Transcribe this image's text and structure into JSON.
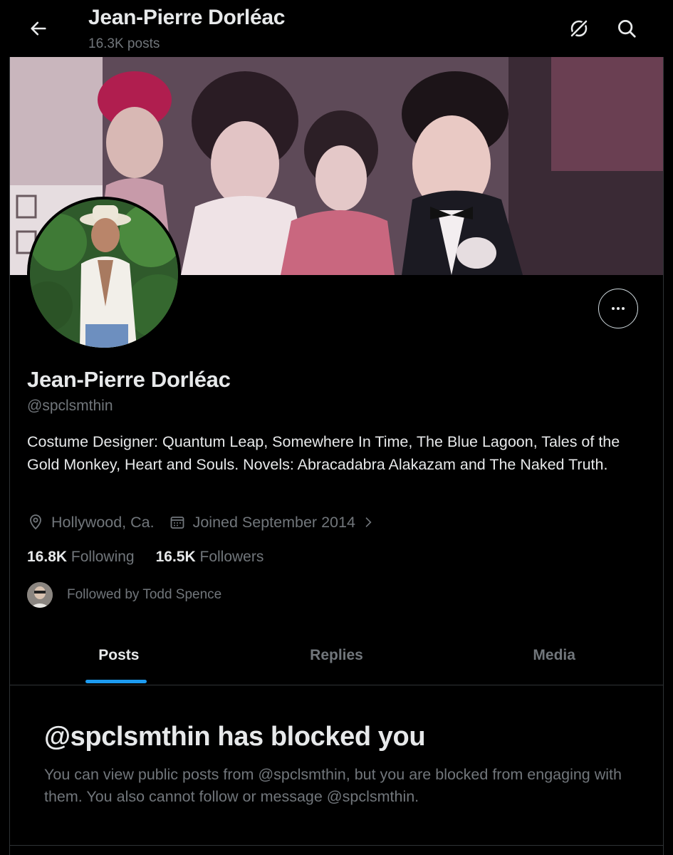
{
  "header": {
    "title": "Jean-Pierre Dorléac",
    "post_count": "16.3K posts"
  },
  "profile": {
    "display_name": "Jean-Pierre Dorléac",
    "handle": "@spclsmthin",
    "bio": "Costume Designer: Quantum Leap, Somewhere In Time, The Blue Lagoon, Tales of the Gold Monkey, Heart and Souls. Novels: Abracadabra Alakazam and The Naked Truth.",
    "location": "Hollywood, Ca.",
    "joined": "Joined September 2014",
    "following_count": "16.8K",
    "following_label": "Following",
    "followers_count": "16.5K",
    "followers_label": "Followers",
    "followed_by": "Followed by Todd Spence"
  },
  "tabs": [
    {
      "label": "Posts",
      "active": true
    },
    {
      "label": "Replies",
      "active": false
    },
    {
      "label": "Media",
      "active": false
    }
  ],
  "blocked": {
    "title": "@spclsmthin has blocked you",
    "message": "You can view public posts from @spclsmthin, but you are blocked from engaging with them. You also cannot follow or message @spclsmthin."
  },
  "colors": {
    "accent": "#1d9bf0",
    "background": "#000000",
    "text_primary": "#e7e9ea",
    "text_secondary": "#71767b"
  }
}
